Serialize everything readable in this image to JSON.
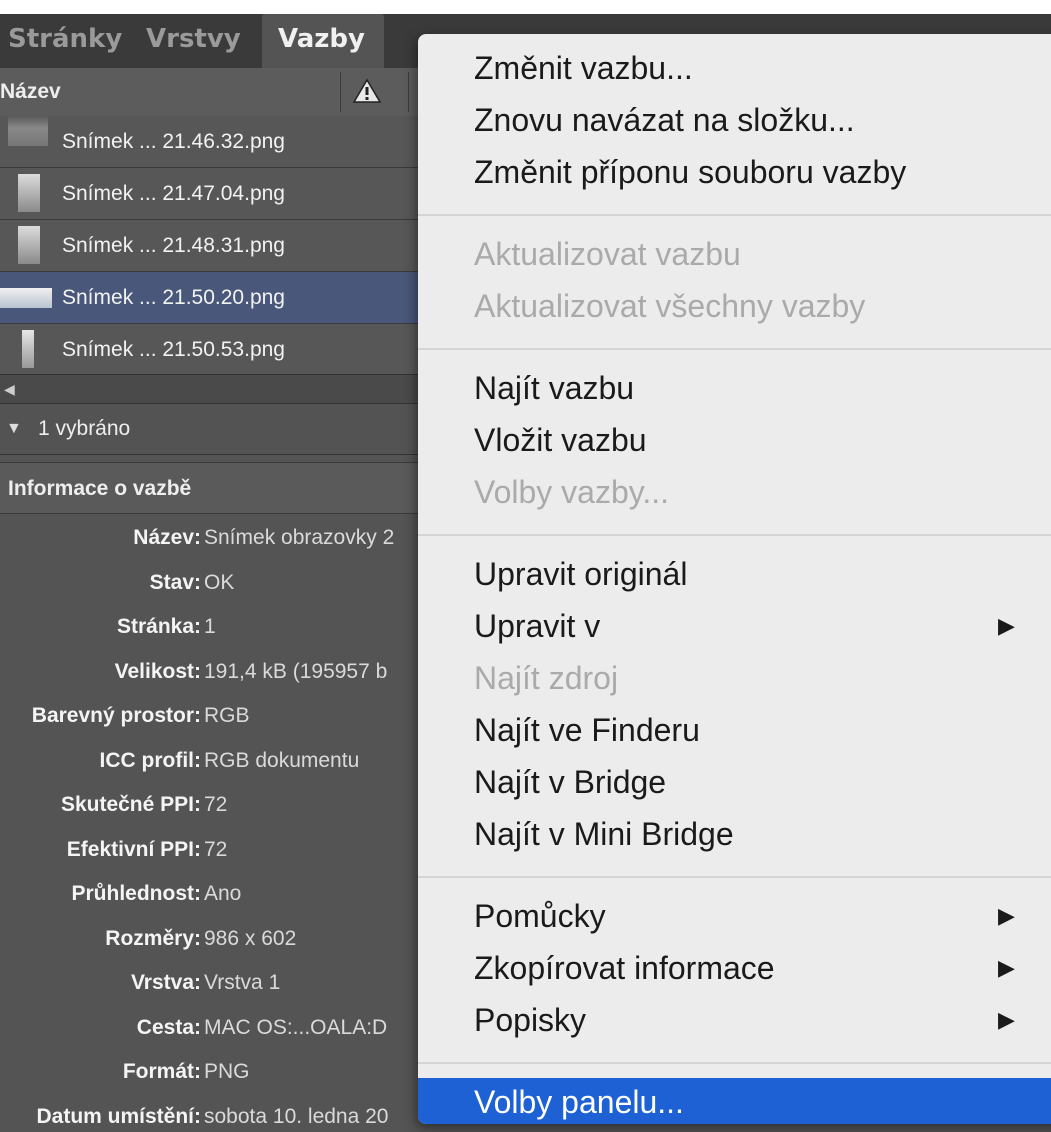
{
  "tabs": [
    "Stránky",
    "Vrstvy",
    "Vazby"
  ],
  "column_header": {
    "name_label": "Název"
  },
  "files": [
    {
      "name": "Snímek ... 21.46.32.png",
      "selected": false
    },
    {
      "name": "Snímek ... 21.47.04.png",
      "selected": false
    },
    {
      "name": "Snímek ... 21.48.31.png",
      "selected": false
    },
    {
      "name": "Snímek ... 21.50.20.png",
      "selected": true
    },
    {
      "name": "Snímek ... 21.50.53.png",
      "selected": false
    }
  ],
  "selection_count": "1 vybráno",
  "info_header": "Informace o vazbě",
  "info": [
    {
      "key": "Název:",
      "value": "Snímek obrazovky 2"
    },
    {
      "key": "Stav:",
      "value": "OK"
    },
    {
      "key": "Stránka:",
      "value": "1"
    },
    {
      "key": "Velikost:",
      "value": "191,4 kB (195957 b"
    },
    {
      "key": "Barevný prostor:",
      "value": "RGB"
    },
    {
      "key": "ICC profil:",
      "value": "RGB dokumentu"
    },
    {
      "key": "Skutečné PPI:",
      "value": "72"
    },
    {
      "key": "Efektivní PPI:",
      "value": "72"
    },
    {
      "key": "Průhlednost:",
      "value": "Ano"
    },
    {
      "key": "Rozměry:",
      "value": "986 x 602"
    },
    {
      "key": "Vrstva:",
      "value": "Vrstva 1"
    },
    {
      "key": "Cesta:",
      "value": "MAC OS:...OALA:D"
    },
    {
      "key": "Formát:",
      "value": "PNG"
    },
    {
      "key": "Datum umístění:",
      "value": "sobota 10. ledna 20"
    }
  ],
  "menu": {
    "groups": [
      [
        {
          "label": "Změnit vazbu...",
          "disabled": false
        },
        {
          "label": "Znovu navázat na složku...",
          "disabled": false
        },
        {
          "label": "Změnit příponu souboru vazby",
          "disabled": false
        }
      ],
      [
        {
          "label": "Aktualizovat vazbu",
          "disabled": true
        },
        {
          "label": "Aktualizovat všechny vazby",
          "disabled": true
        }
      ],
      [
        {
          "label": "Najít vazbu",
          "disabled": false
        },
        {
          "label": "Vložit vazbu",
          "disabled": false
        },
        {
          "label": "Volby vazby...",
          "disabled": true
        }
      ],
      [
        {
          "label": "Upravit originál",
          "disabled": false
        },
        {
          "label": "Upravit v",
          "disabled": false,
          "submenu": true
        },
        {
          "label": "Najít zdroj",
          "disabled": true
        },
        {
          "label": "Najít ve Finderu",
          "disabled": false
        },
        {
          "label": "Najít v Bridge",
          "disabled": false
        },
        {
          "label": "Najít v Mini Bridge",
          "disabled": false
        }
      ],
      [
        {
          "label": "Pomůcky",
          "disabled": false,
          "submenu": true
        },
        {
          "label": "Zkopírovat informace",
          "disabled": false,
          "submenu": true
        },
        {
          "label": "Popisky",
          "disabled": false,
          "submenu": true
        }
      ],
      [
        {
          "label": "Volby panelu...",
          "disabled": false,
          "highlighted": true
        }
      ]
    ],
    "submenu_icon": "triangle-right-icon",
    "highlight_color": "#1d61d4"
  }
}
